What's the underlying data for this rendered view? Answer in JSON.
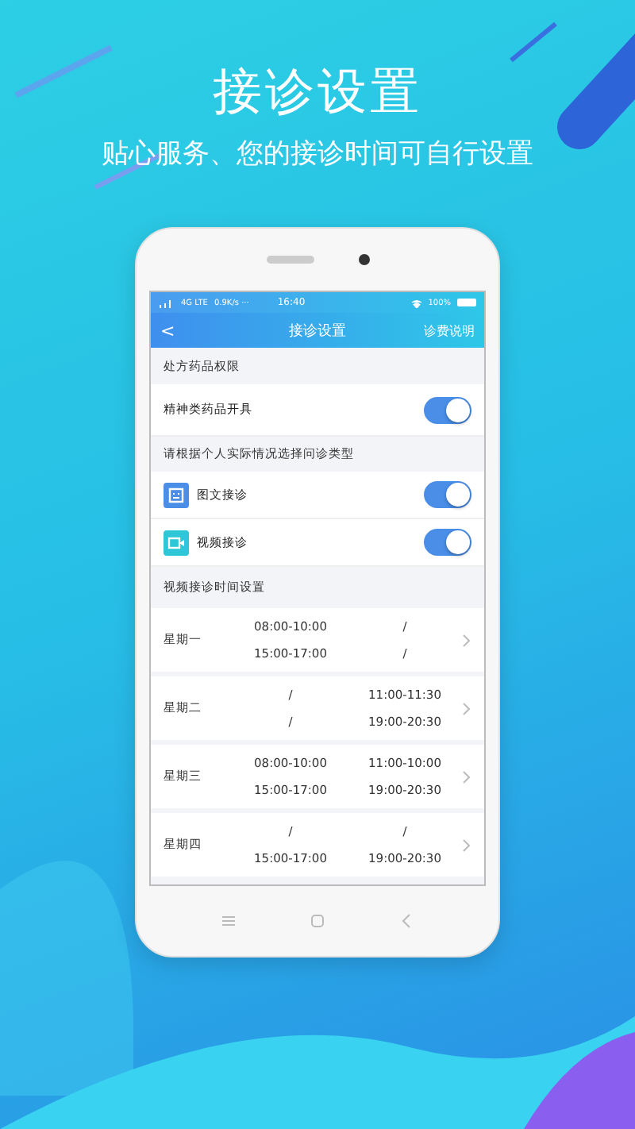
{
  "promo": {
    "title": "接诊设置",
    "subtitle": "贴心服务、您的接诊时间可自行设置"
  },
  "status_bar": {
    "network": "4G LTE",
    "speed": "0.9K/s ···",
    "time": "16:40",
    "battery": "100%"
  },
  "nav": {
    "back": "<",
    "title": "接诊设置",
    "action": "诊费说明"
  },
  "sections": [
    {
      "header": "处方药品权限",
      "items": [
        {
          "label": "精神类药品开具",
          "kind": "plain",
          "on": true
        }
      ]
    },
    {
      "header": "请根据个人实际情况选择问诊类型",
      "items": [
        {
          "label": "图文接诊",
          "kind": "text",
          "on": true
        },
        {
          "label": "视频接诊",
          "kind": "video",
          "on": true
        }
      ]
    }
  ],
  "schedule": {
    "header": "视频接诊时间设置",
    "days": [
      {
        "day": "星期一",
        "slots": [
          "08:00-10:00",
          "/",
          "15:00-17:00",
          "/"
        ]
      },
      {
        "day": "星期二",
        "slots": [
          "/",
          "11:00-11:30",
          "/",
          "19:00-20:30"
        ]
      },
      {
        "day": "星期三",
        "slots": [
          "08:00-10:00",
          "11:00-10:00",
          "15:00-17:00",
          "19:00-20:30"
        ]
      },
      {
        "day": "星期四",
        "slots": [
          "/",
          "/",
          "15:00-17:00",
          "19:00-20:30"
        ]
      }
    ]
  }
}
